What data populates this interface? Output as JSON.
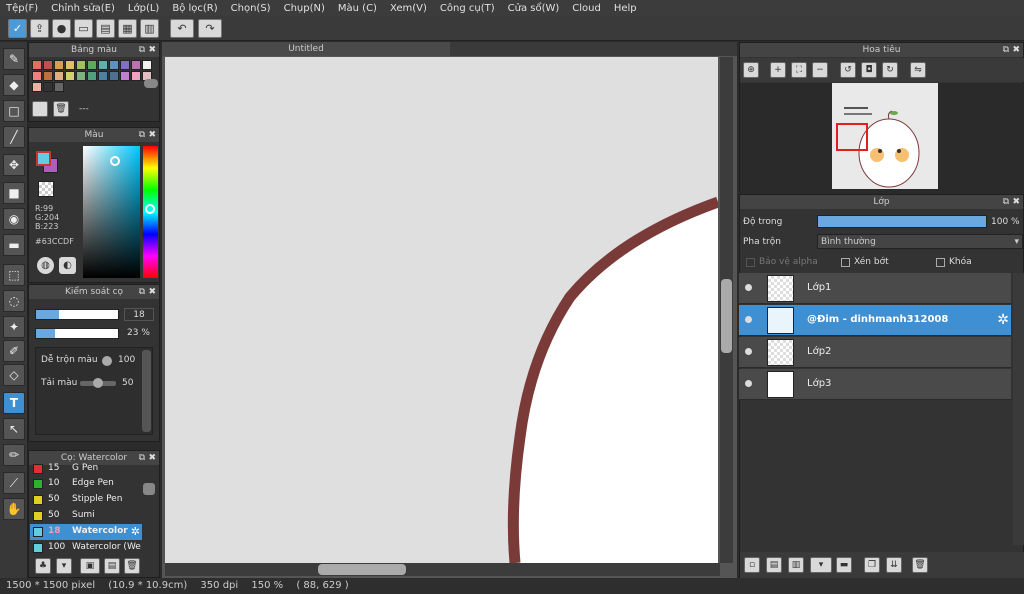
{
  "menu": [
    "Tệp(F)",
    "Chỉnh sửa(E)",
    "Lớp(L)",
    "Bộ lọc(R)",
    "Chọn(S)",
    "Chụp(N)",
    "Màu (C)",
    "Xem(V)",
    "Công cụ(T)",
    "Cửa sổ(W)",
    "Cloud",
    "Help"
  ],
  "colors_panel": {
    "title": "Bảng màu",
    "swatches": [
      "#e07060",
      "#c05050",
      "#d4a050",
      "#e0c060",
      "#a0c060",
      "#60a860",
      "#60b0b0",
      "#6090c0",
      "#8070c0",
      "#c070b0",
      "#f0f0f0",
      "#f08080",
      "#c07040",
      "#e0b080",
      "#d0d070",
      "#80b080",
      "#50a080",
      "#5080a0",
      "#507090",
      "#c080d0",
      "#f0a0c0",
      "#e0c0c0",
      "#f0b0a0",
      "#333333",
      "#666666"
    ],
    "footer_text": "---"
  },
  "color_panel": {
    "title": "Màu",
    "r": "R:99",
    "g": "G:204",
    "b": "B:223",
    "hex": "#63CCDF",
    "fg_color": "#63ccdf",
    "bg_color": "#b05cc0"
  },
  "brush_control": {
    "title": "Kiểm soát cọ",
    "size": "18",
    "opacity": "23 %",
    "blend_label": "Dễ trộn màu",
    "blend_value": "100",
    "reload_label": "Tải màu",
    "reload_value": "50",
    "size_fraction": 0.28,
    "opacity_fraction": 0.23
  },
  "brush_panel": {
    "title": "Cọ: Watercolor",
    "items": [
      {
        "size": "15",
        "name": "G Pen",
        "color": "#e03030"
      },
      {
        "size": "10",
        "name": "Edge Pen",
        "color": "#30b030"
      },
      {
        "size": "50",
        "name": "Stipple Pen",
        "color": "#e0d020"
      },
      {
        "size": "50",
        "name": "Sumi",
        "color": "#e0d020"
      },
      {
        "size": "18",
        "name": "Watercolor",
        "color": "#63ccdf"
      },
      {
        "size": "100",
        "name": "Watercolor (We",
        "color": "#63ccdf"
      }
    ]
  },
  "canvas": {
    "tab_title": "Untitled",
    "stroke_color": "#7a3a38"
  },
  "navigator": {
    "title": "Hoa tiêu"
  },
  "layers": {
    "title": "Lớp",
    "opacity_label": "Độ trong",
    "opacity_value": "100 %",
    "opacity_fraction": 1.0,
    "blend_label": "Pha trộn",
    "blend_value": "Bình thường",
    "protect_alpha": "Bảo vệ alpha",
    "clipping": "Xén bớt",
    "lock": "Khóa",
    "items": [
      {
        "name": "Lớp1"
      },
      {
        "name": "@Đim - dinhmanh312008"
      },
      {
        "name": "Lớp2"
      },
      {
        "name": "Lớp3"
      }
    ]
  },
  "status": {
    "pixels": "1500 * 1500 pixel",
    "size_cm": "(10.9 * 10.9cm)",
    "dpi": "350 dpi",
    "zoom": "150 %",
    "coords": "( 88, 629 )"
  }
}
